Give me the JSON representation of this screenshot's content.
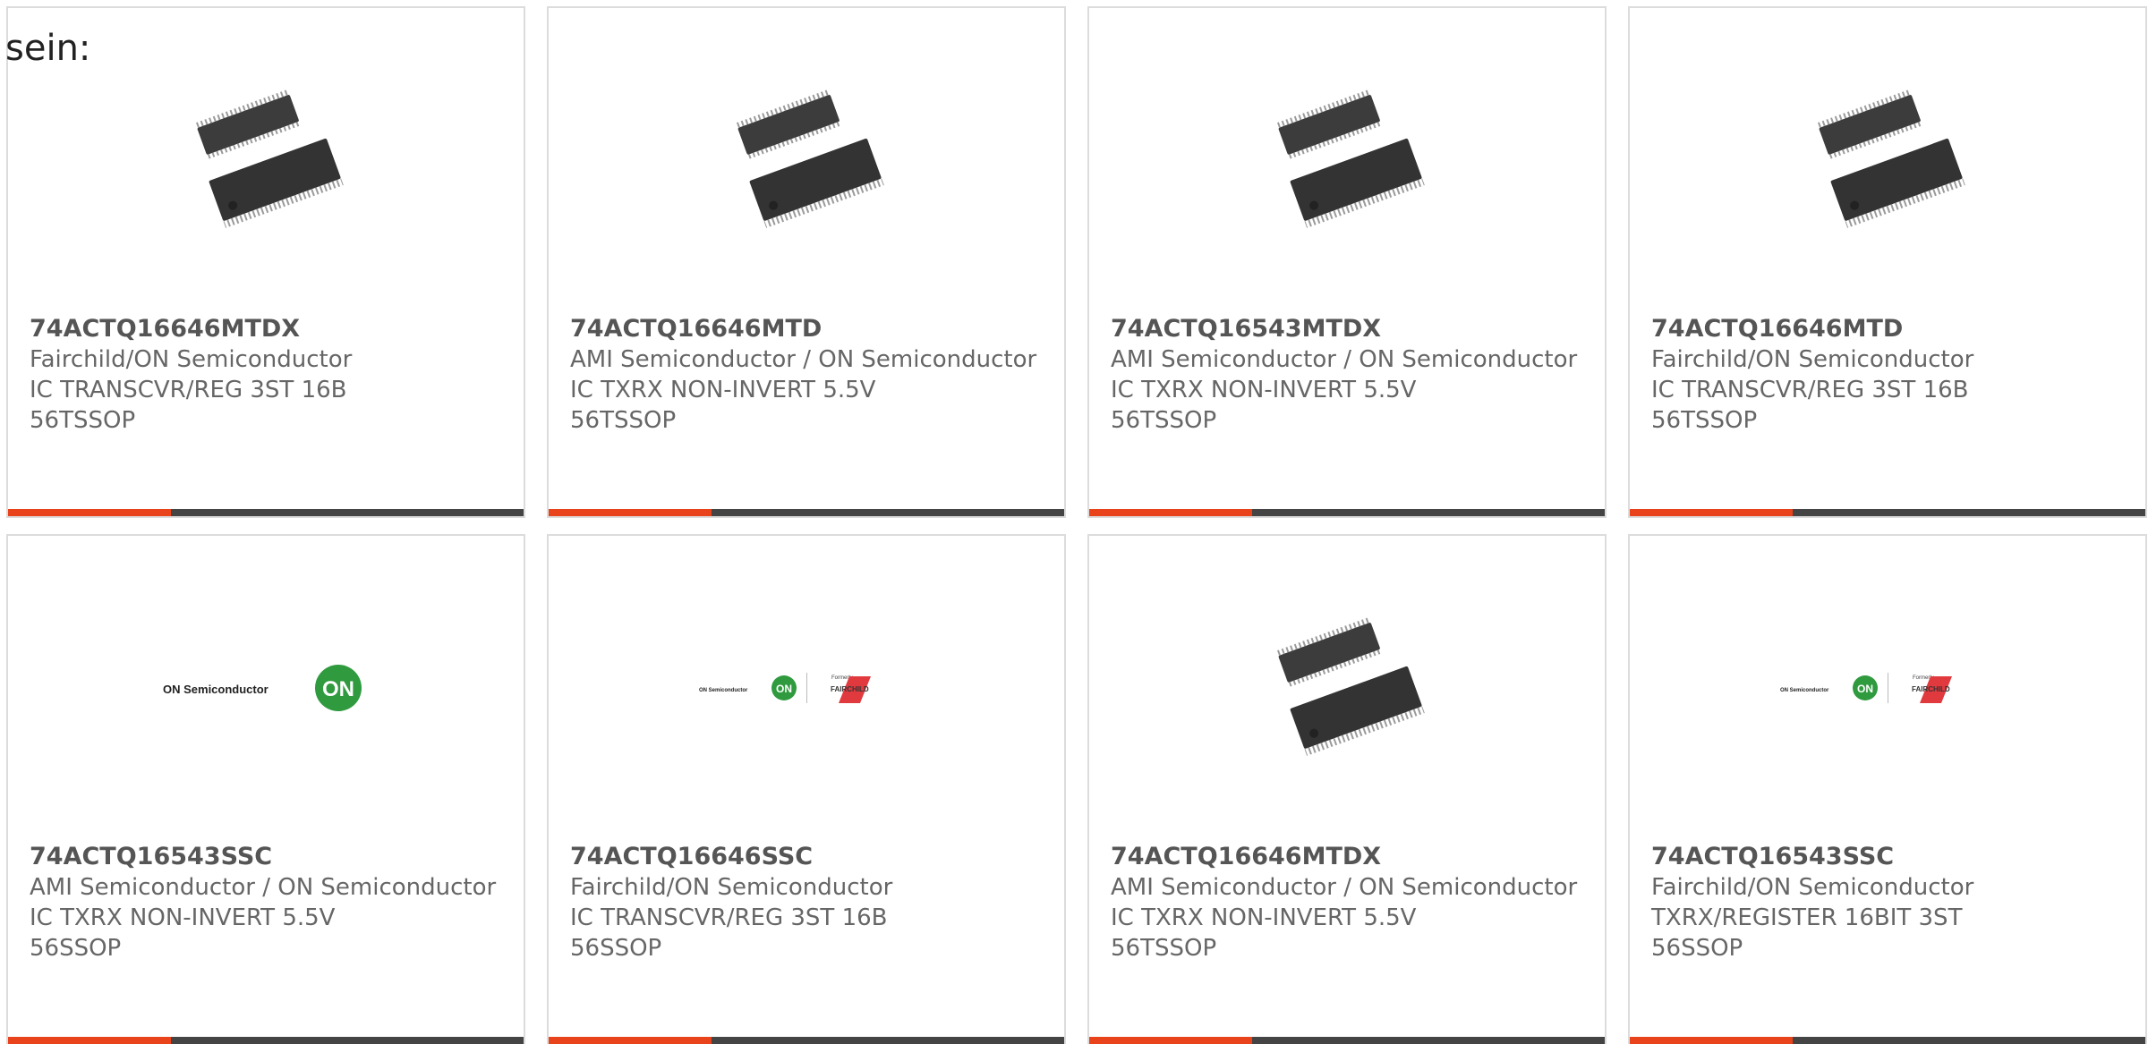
{
  "intro_text": "sein:",
  "colors": {
    "accent": "#e8431b",
    "bar_dark": "#444444",
    "border": "#dcdcdc",
    "text": "#666666",
    "title": "#555555",
    "on_green": "#2f9a3e",
    "fairchild_red": "#e03a3e"
  },
  "on_logo_text": "ON Semiconductor",
  "on_badge_text": "ON",
  "formerly_text": "Formerly",
  "fairchild_text": "FAIRCHILD",
  "cards": [
    {
      "image": "chip-icon",
      "part_number": "74ACTQ16646MTDX",
      "manufacturer": "Fairchild/ON Semiconductor",
      "description": "IC TRANSCVR/REG 3ST 16B",
      "package": "56TSSOP"
    },
    {
      "image": "chip-icon",
      "part_number": "74ACTQ16646MTD",
      "manufacturer": "AMI Semiconductor / ON Semiconductor",
      "description": "IC TXRX NON-INVERT 5.5V",
      "package": "56TSSOP"
    },
    {
      "image": "chip-icon",
      "part_number": "74ACTQ16543MTDX",
      "manufacturer": "AMI Semiconductor / ON Semiconductor",
      "description": "IC TXRX NON-INVERT 5.5V",
      "package": "56TSSOP"
    },
    {
      "image": "chip-icon",
      "part_number": "74ACTQ16646MTD",
      "manufacturer": "Fairchild/ON Semiconductor",
      "description": "IC TRANSCVR/REG 3ST 16B",
      "package": "56TSSOP"
    },
    {
      "image": "on-semiconductor-logo",
      "part_number": "74ACTQ16543SSC",
      "manufacturer": "AMI Semiconductor / ON Semiconductor",
      "description": "IC TXRX NON-INVERT 5.5V",
      "package": "56SSOP"
    },
    {
      "image": "on-fairchild-logo",
      "part_number": "74ACTQ16646SSC",
      "manufacturer": "Fairchild/ON Semiconductor",
      "description": "IC TRANSCVR/REG 3ST 16B",
      "package": "56SSOP"
    },
    {
      "image": "chip-icon",
      "part_number": "74ACTQ16646MTDX",
      "manufacturer": "AMI Semiconductor / ON Semiconductor",
      "description": "IC TXRX NON-INVERT 5.5V",
      "package": "56TSSOP"
    },
    {
      "image": "on-fairchild-logo",
      "part_number": "74ACTQ16543SSC",
      "manufacturer": "Fairchild/ON Semiconductor",
      "description": "TXRX/REGISTER 16BIT 3ST",
      "package": "56SSOP"
    }
  ]
}
